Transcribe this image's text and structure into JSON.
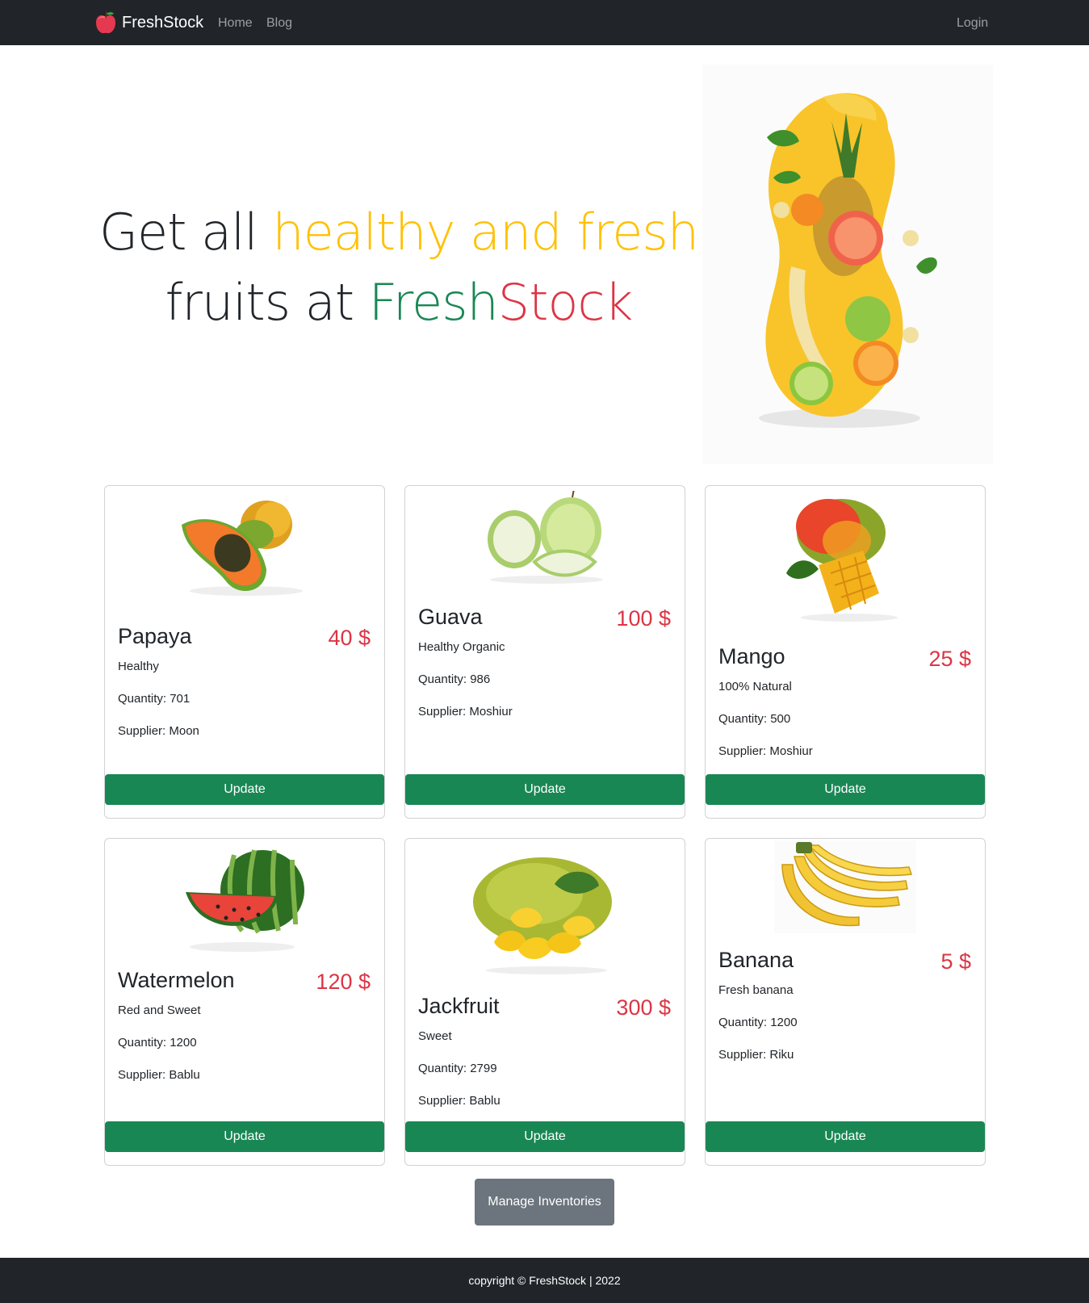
{
  "nav": {
    "brand": "FreshStock",
    "links": [
      "Home",
      "Blog"
    ],
    "login": "Login"
  },
  "hero": {
    "line1_a": "Get all ",
    "line1_b": "healthy and fresh",
    "line2_a": "fruits at ",
    "line2_b": "Fresh",
    "line2_c": "Stock"
  },
  "products": [
    {
      "name": "Papaya",
      "price": "40 $",
      "description": "Healthy",
      "quantity": "Quantity: 701",
      "supplier": "Supplier: Moon",
      "button": "Update"
    },
    {
      "name": "Guava",
      "price": "100 $",
      "description": "Healthy Organic",
      "quantity": "Quantity: 986",
      "supplier": "Supplier: Moshiur",
      "button": "Update"
    },
    {
      "name": "Mango",
      "price": "25 $",
      "description": "100% Natural",
      "quantity": "Quantity: 500",
      "supplier": "Supplier: Moshiur",
      "button": "Update"
    },
    {
      "name": "Watermelon",
      "price": "120 $",
      "description": "Red and Sweet",
      "quantity": "Quantity: 1200",
      "supplier": "Supplier: Bablu",
      "button": "Update"
    },
    {
      "name": "Jackfruit",
      "price": "300 $",
      "description": "Sweet",
      "quantity": "Quantity: 2799",
      "supplier": "Supplier: Bablu",
      "button": "Update"
    },
    {
      "name": "Banana",
      "price": "5 $",
      "description": "Fresh banana",
      "quantity": "Quantity: 1200",
      "supplier": "Supplier: Riku",
      "button": "Update"
    }
  ],
  "manage_button": "Manage Inventories",
  "footer": "copyright © FreshStock | 2022",
  "colors": {
    "navbar": "#212529",
    "accent_yellow": "#ffc107",
    "brand_green": "#198754",
    "price_red": "#dc3545",
    "manage_gray": "#6c757d"
  },
  "icons": {
    "brand": "apple-icon"
  }
}
